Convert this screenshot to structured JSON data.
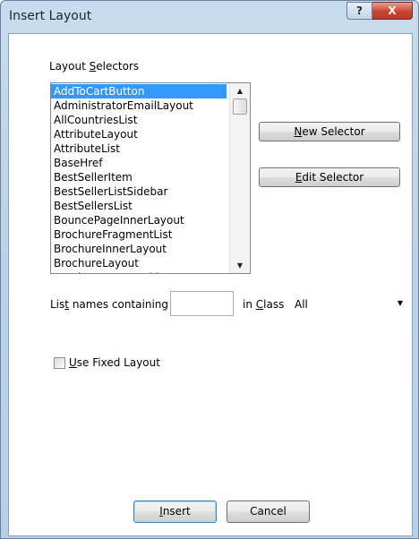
{
  "window": {
    "title": "Insert Layout",
    "help_label": "?",
    "close_label": "X"
  },
  "selectors": {
    "label_pre": "Layout ",
    "label_key": "S",
    "label_post": "electors",
    "items": [
      "AddToCartButton",
      "AdministratorEmailLayout",
      "AllCountriesList",
      "AttributeLayout",
      "AttributeList",
      "BaseHref",
      "BestSellerItem",
      "BestSellerListSidebar",
      "BestSellersList",
      "BouncePageInnerLayout",
      "BrochureFragmentList",
      "BrochureInnerLayout",
      "BrochureLayout",
      "BrochureLayoutWidgets"
    ],
    "selected_index": 0
  },
  "buttons": {
    "new_selector": {
      "key": "N",
      "rest": "ew Selector"
    },
    "edit_selector": {
      "key": "E",
      "rest": "dit Selector"
    },
    "insert": {
      "key": "I",
      "rest": "nsert"
    },
    "cancel": "Cancel"
  },
  "filter": {
    "names_pre": "Lis",
    "names_key": "t",
    "names_post": " names containing",
    "names_value": "",
    "class_pre": "in ",
    "class_key": "C",
    "class_post": "lass",
    "class_value": "All"
  },
  "fixed_layout": {
    "key": "U",
    "rest": "se Fixed Layout",
    "checked": false
  },
  "icons": {
    "scroll_up": "scroll-up-arrow-icon",
    "scroll_down": "scroll-down-arrow-icon",
    "dropdown": "dropdown-arrow-icon"
  }
}
